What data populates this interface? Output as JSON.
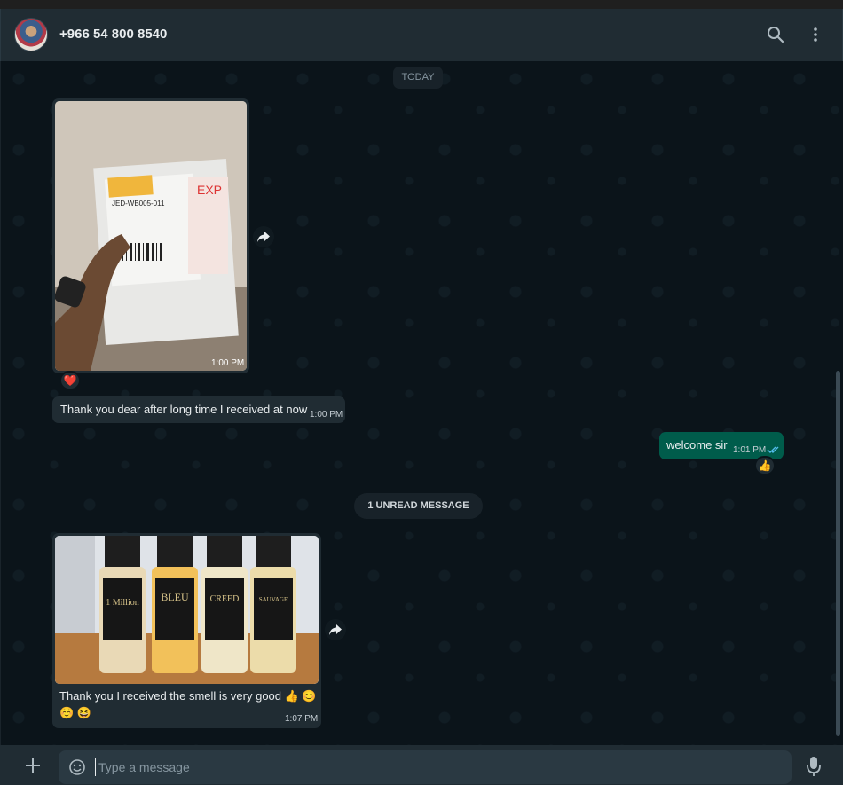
{
  "header": {
    "contact": "+966 54 800 8540"
  },
  "chat": {
    "date_divider": "TODAY",
    "unread_divider": "1 UNREAD MESSAGE",
    "messages": [
      {
        "type": "image",
        "direction": "incoming",
        "time": "1:00 PM",
        "reaction": "❤️",
        "image": "package-photo"
      },
      {
        "type": "text",
        "direction": "incoming",
        "text": "Thank you dear after long time I received at now",
        "time": "1:00 PM"
      },
      {
        "type": "text",
        "direction": "outgoing",
        "text": "welcome sir",
        "time": "1:01 PM",
        "reaction": "👍"
      },
      {
        "type": "image",
        "direction": "incoming",
        "time": "1:07 PM",
        "caption": "Thank you I received the smell is very good 👍 😊",
        "caption2": "☺️ 😆",
        "image": "perfume-bottles-photo",
        "bottle_labels": [
          "1 Million",
          "BLEU",
          "CREED",
          "SAUVAGE"
        ]
      }
    ]
  },
  "composer": {
    "placeholder": "Type a message"
  },
  "colors": {
    "header": "#202c33",
    "background": "#0b141a",
    "incoming": "#202c33",
    "outgoing": "#005c4b"
  }
}
